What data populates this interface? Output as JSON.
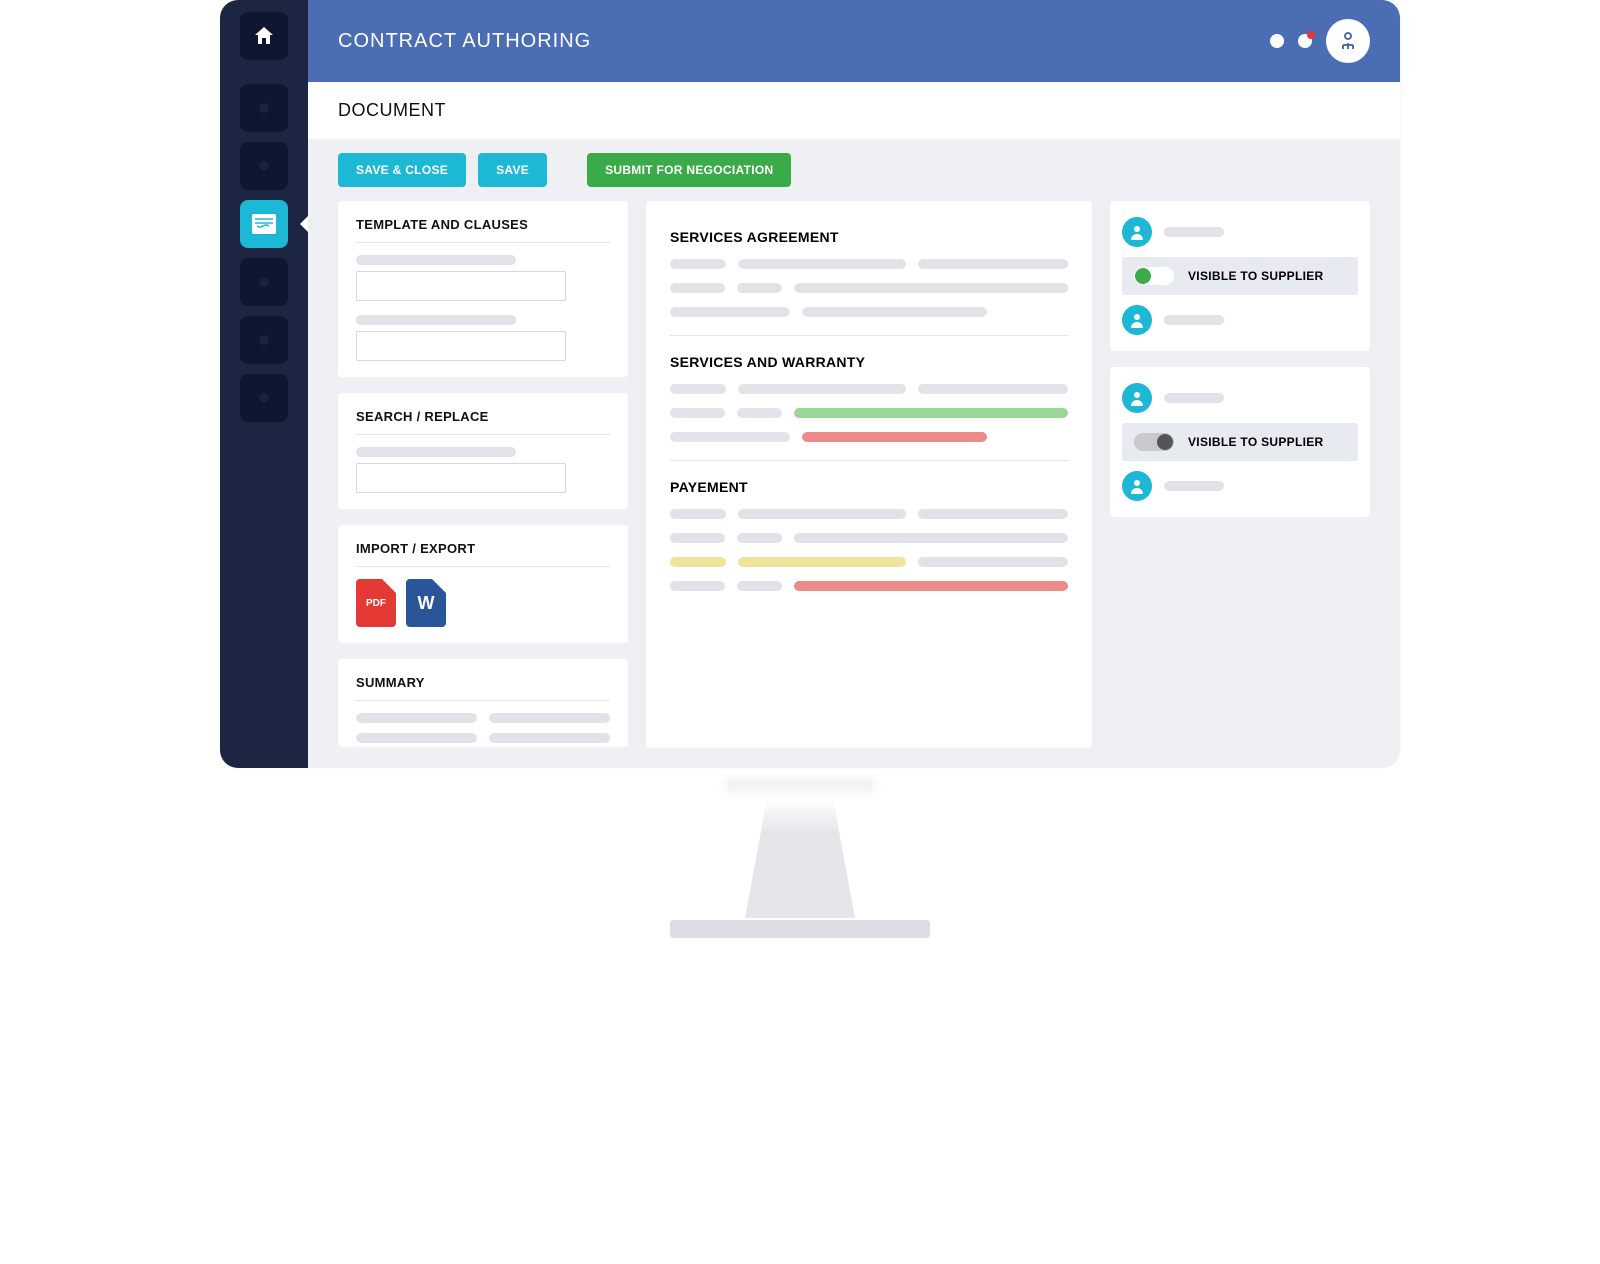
{
  "header": {
    "title": "CONTRACT AUTHORING"
  },
  "section": {
    "title": "DOCUMENT"
  },
  "toolbar": {
    "save_close": "SAVE & CLOSE",
    "save": "SAVE",
    "submit": "SUBMIT FOR NEGOCIATION"
  },
  "left_panels": {
    "template": {
      "title": "TEMPLATE AND CLAUSES"
    },
    "search": {
      "title": "SEARCH / REPLACE"
    },
    "import": {
      "title": "IMPORT / EXPORT",
      "pdf_label": "PDF",
      "word_label": "W"
    },
    "summary": {
      "title": "SUMMARY"
    }
  },
  "doc": {
    "s1": "SERVICES AGREEMENT",
    "s2": "SERVICES AND WARRANTY",
    "s3": "PAYEMENT"
  },
  "right": {
    "toggle1": "VISIBLE TO SUPPLIER",
    "toggle2": "VISIBLE TO SUPPLIER"
  }
}
